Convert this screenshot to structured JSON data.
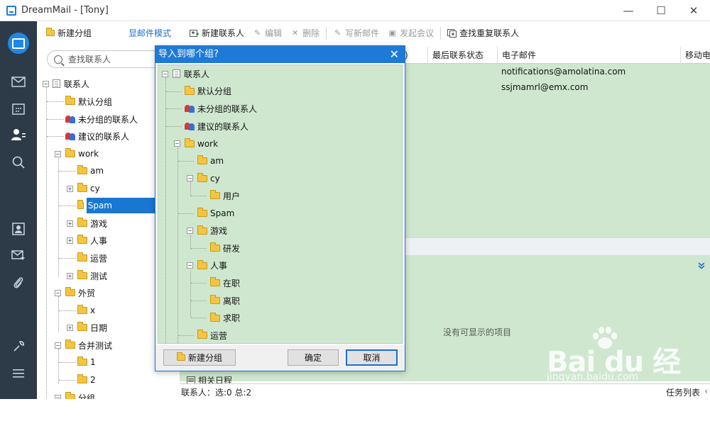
{
  "window": {
    "title": "DreamMail - [Tony]",
    "minimize": "—",
    "maximize": "☐",
    "close": "✕"
  },
  "toolbar": {
    "new_group": "新建分组",
    "show_mail_mode": "显邮件模式",
    "new_contact": "新建联系人",
    "edit": "编辑",
    "delete": "删除",
    "write_mail": "写新邮件",
    "start_meeting": "发起会议",
    "find_duplicates": "查找重复联系人"
  },
  "search": {
    "placeholder": "查找联系人"
  },
  "tree": {
    "items": [
      {
        "label": "联系人",
        "icon": "book-icon"
      },
      {
        "label": "默认分组",
        "icon": "folder-icon"
      },
      {
        "label": "未分组的联系人",
        "icon": "people-icon"
      },
      {
        "label": "建议的联系人",
        "icon": "people-icon"
      },
      {
        "label": "work",
        "icon": "folder-icon"
      },
      {
        "label": "am",
        "icon": "folder-icon"
      },
      {
        "label": "cy",
        "icon": "folder-icon"
      },
      {
        "label": "Spam",
        "icon": "folder-icon"
      },
      {
        "label": "游戏",
        "icon": "folder-icon"
      },
      {
        "label": "人事",
        "icon": "folder-icon"
      },
      {
        "label": "运营",
        "icon": "folder-icon"
      },
      {
        "label": "测试",
        "icon": "folder-icon"
      },
      {
        "label": "外贸",
        "icon": "folder-icon"
      },
      {
        "label": "x",
        "icon": "folder-icon"
      },
      {
        "label": "日期",
        "icon": "folder-icon"
      },
      {
        "label": "合并测试",
        "icon": "folder-icon"
      },
      {
        "label": "1",
        "icon": "folder-icon"
      },
      {
        "label": "2",
        "icon": "folder-icon"
      },
      {
        "label": "分组",
        "icon": "folder-icon"
      }
    ]
  },
  "list": {
    "columns": [
      ")",
      "最后联系状态",
      "电子邮件",
      "移动电"
    ],
    "rows": [
      {
        "email": "notifications@amolatina.com"
      },
      {
        "email": "ssjmamrl@emx.com"
      }
    ]
  },
  "detail": {
    "empty_text": "没有可显示的项目",
    "calendar_label": "相关日程"
  },
  "status": {
    "left": "联系人：选:0 总:2",
    "right": "任务列表"
  },
  "dialog": {
    "title": "导入到哪个组?",
    "items": [
      {
        "label": "联系人"
      },
      {
        "label": "默认分组"
      },
      {
        "label": "未分组的联系人"
      },
      {
        "label": "建议的联系人"
      },
      {
        "label": "work"
      },
      {
        "label": "am"
      },
      {
        "label": "cy"
      },
      {
        "label": "用户"
      },
      {
        "label": "Spam"
      },
      {
        "label": "游戏"
      },
      {
        "label": "研发"
      },
      {
        "label": "人事"
      },
      {
        "label": "在职"
      },
      {
        "label": "离职"
      },
      {
        "label": "求职"
      },
      {
        "label": "运营"
      }
    ],
    "new_group_button": "新建分组",
    "ok_button": "确定",
    "cancel_button": "取消"
  },
  "watermark": {
    "brand": "Bai du 经验",
    "url": "jingyan.baidu.com"
  }
}
